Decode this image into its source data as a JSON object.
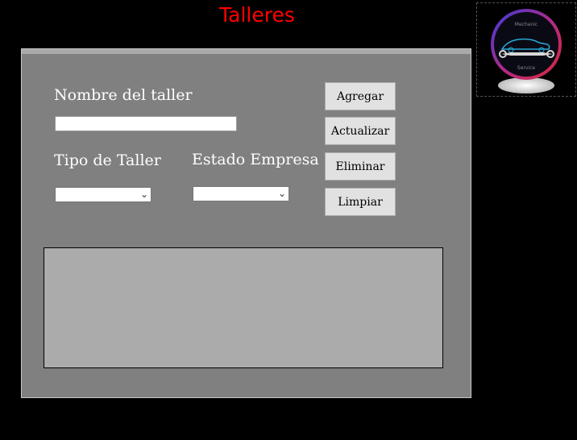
{
  "header": {
    "title": "Talleres"
  },
  "logo": {
    "top_text": "Mechanic",
    "bottom_text": "Service"
  },
  "form": {
    "nombre_label": "Nombre del taller",
    "nombre_value": "",
    "tipo_label": "Tipo de Taller",
    "tipo_value": "",
    "estado_label": "Estado Empresa",
    "estado_value": ""
  },
  "buttons": {
    "agregar": "Agregar",
    "actualizar": "Actualizar",
    "eliminar": "Eliminar",
    "limpiar": "Limpiar"
  },
  "colors": {
    "title": "#ff0000",
    "panel": "#808080",
    "grid": "#ababab",
    "button": "#e1e1e1"
  }
}
